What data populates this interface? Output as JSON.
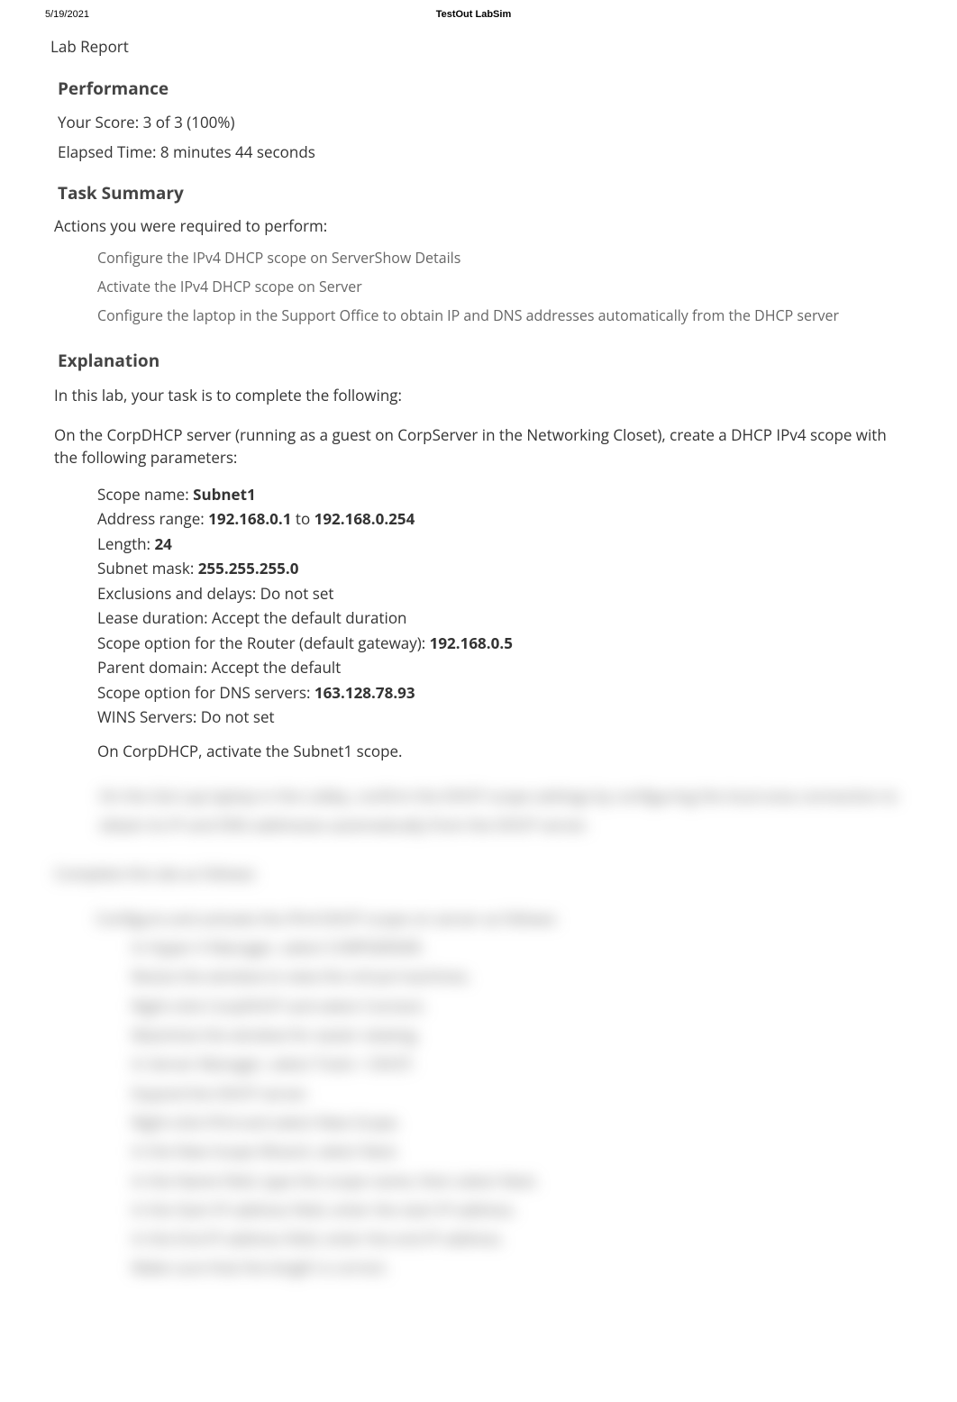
{
  "header": {
    "date": "5/19/2021",
    "product": "TestOut LabSim"
  },
  "report": {
    "title": "Lab Report"
  },
  "performance": {
    "heading": "Performance",
    "score_label": "Your Score: ",
    "score_value": "3 of 3 (100%)",
    "elapsed_label": "Elapsed Time: ",
    "elapsed_value": "8 minutes 44 seconds"
  },
  "task_summary": {
    "heading": "Task Summary",
    "intro": "Actions you were required to perform:",
    "items": [
      "Configure the IPv4 DHCP scope on ServerShow Details",
      "Activate the IPv4 DHCP scope on Server",
      "Configure the laptop in the Support Office to obtain IP and DNS addresses automatically from the DHCP server"
    ]
  },
  "explanation": {
    "heading": "Explanation",
    "intro": "In this lab, your task is to complete the following:",
    "para": "On the CorpDHCP server (running as a guest on CorpServer in the Networking Closet), create a DHCP IPv4 scope with the following parameters:",
    "bullets": {
      "scope_name_l": "Scope name: ",
      "scope_name_v": "Subnet1",
      "addr_l": "Address range: ",
      "addr_v1": "192.168.0.1",
      "addr_to": " to ",
      "addr_v2": "192.168.0.254",
      "length_l": "Length: ",
      "length_v": "24",
      "mask_l": "Subnet mask: ",
      "mask_v": "255.255.255.0",
      "excl": "Exclusions and delays: Do not set",
      "lease": "Lease duration: Accept the default duration",
      "router_l": "Scope option for the Router (default gateway): ",
      "router_v": "192.168.0.5",
      "parent": "Parent domain: Accept the default",
      "dns_l": "Scope option for DNS servers: ",
      "dns_v": "163.128.78.93",
      "wins": "WINS Servers: Do not set"
    },
    "activate": "On CorpDHCP, activate the Subnet1 scope.",
    "hidden_bullet": "On the Gst-Lap laptop in the Lobby, confirm the DHCP scope settings by configuring the local area connection to obtain its IP and DNS addresses automatically from the DHCP server.",
    "hidden_intro": "Complete this lab as follows:",
    "hidden_steps": [
      "Configure and activate the IPv4 DHCP scope on server as follows:",
      "In Hyper-V Manager, select CORPSERVER.",
      "Resize the window to view the virtual machines.",
      "Right-click CorpDHCP and select Connect.",
      "Maximize the window for easier viewing.",
      "In Server Manager, select Tools > DHCP.",
      "Expand the DHCP server.",
      "Right-click IPv4 and select New Scope.",
      "In the New Scope Wizard, select Next.",
      "In the Name field, type the scope name; then select Next.",
      "In the Start IP address field, enter the start IP address.",
      "In the End IP address field, enter the end IP address.",
      "Make sure that the length is correct."
    ]
  }
}
